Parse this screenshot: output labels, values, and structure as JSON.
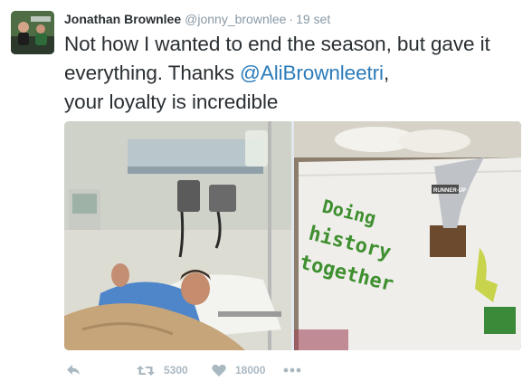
{
  "tweet": {
    "author_name": "Jonathan Brownlee",
    "handle": "@jonny_brownlee",
    "separator": "·",
    "timestamp": "19 set",
    "text_before": "Not how I wanted to end the season,  but gave it everything. Thanks ",
    "mention": "@AliBrownleetri",
    "text_after": ",\nyour loyalty is incredible",
    "photo_banner_text": [
      "Doing",
      "history",
      "together"
    ],
    "photo_trophy_text": "RUNNER-UP"
  },
  "actions": {
    "reply_icon": "reply-icon",
    "retweet_icon": "retweet-icon",
    "retweet_count": "5300",
    "like_icon": "heart-icon",
    "like_count": "18000",
    "more_icon": "more-dots-icon"
  },
  "colors": {
    "name": "#292f33",
    "meta": "#8899a6",
    "mention": "#2b7bb9",
    "action": "#aab8c2",
    "banner_green": "#3e8f2f"
  }
}
